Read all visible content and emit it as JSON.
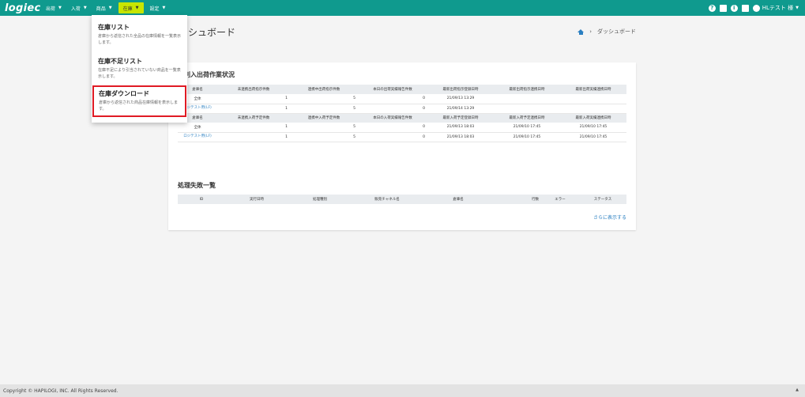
{
  "app": {
    "logo": "logiec"
  },
  "nav": {
    "items": [
      {
        "label": "出荷"
      },
      {
        "label": "入荷"
      },
      {
        "label": "商品"
      },
      {
        "label": "在庫"
      },
      {
        "label": "設定"
      }
    ],
    "user_label": "HLテスト 様"
  },
  "dropdown": {
    "items": [
      {
        "title": "在庫リスト",
        "desc": "倉庫から返信された全品の在庫情報を一覧表示します。"
      },
      {
        "title": "在庫不足リスト",
        "desc": "在庫不足により引当されていない商品を一覧表示します。"
      },
      {
        "title": "在庫ダウンロード",
        "desc": "倉庫から返信された商品在庫情報を表示します。"
      }
    ]
  },
  "page": {
    "title": "ダッシュボード",
    "title_visible": "シュボード",
    "breadcrumb": "ダッシュボード"
  },
  "section1": {
    "title": "倉庫別入出荷作業状況",
    "title_visible": "庫別入出荷作業状況",
    "ship_headers": [
      "倉庫名",
      "未連携出荷指示件数",
      "連携中出荷指示件数",
      "本日の出荷実績報告件数",
      "最新出荷指示登録日時",
      "最新出荷指示連携日時",
      "最新出荷実績連携日時"
    ],
    "ship_rows": [
      [
        "全体",
        "1",
        "5",
        "0",
        "21/09/13 13:29",
        "",
        ""
      ],
      [
        "ロジテスト用(LF)",
        "1",
        "5",
        "0",
        "21/09/14 13:29",
        "",
        ""
      ]
    ],
    "recv_headers": [
      "倉庫名",
      "未連携入荷予定件数",
      "連携中入荷予定件数",
      "本日の入荷実績報告件数",
      "最新入荷予定登録日時",
      "最新入荷予定連携日時",
      "最新入荷実績連携日時"
    ],
    "recv_rows": [
      [
        "全体",
        "1",
        "5",
        "0",
        "21/09/13 18:03",
        "21/09/10 17:45",
        "21/09/10 17:45"
      ],
      [
        "ロジテスト用(LF)",
        "1",
        "5",
        "0",
        "21/09/13 18:03",
        "21/09/10 17:45",
        "21/09/10 17:45"
      ]
    ]
  },
  "section2": {
    "title": "処理失敗一覧",
    "headers": [
      "ID",
      "実行日時",
      "処理種別",
      "販売チャネル名",
      "倉庫名",
      "行数",
      "エラー",
      "ステータス"
    ],
    "more_link": "さらに表示する"
  },
  "footer": {
    "copyright": "Copyright © HAPILOGI, INC. All Rights Reserved."
  }
}
